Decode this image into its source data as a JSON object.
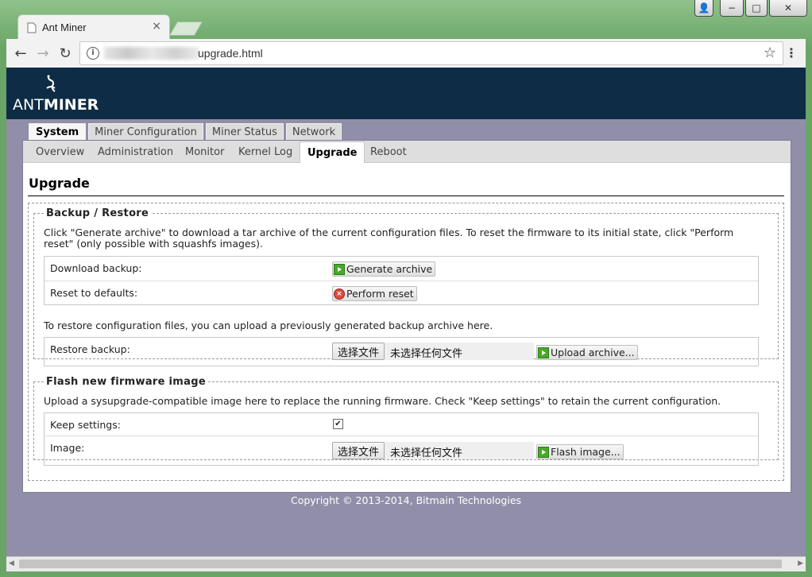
{
  "browser": {
    "tab_title": "Ant Miner",
    "tab_close": "×",
    "url_visible": "upgrade.html",
    "back": "←",
    "forward": "→",
    "reload": "↻",
    "info": "i",
    "bookmark": "☆",
    "menu": "⋮",
    "window_controls": {
      "user": "👤",
      "minimize": "−",
      "maximize": "□",
      "close": "✕"
    }
  },
  "header": {
    "logo_text_light": "ANT",
    "logo_text_bold": "MINER"
  },
  "top_tabs": [
    {
      "label": "System",
      "active": true
    },
    {
      "label": "Miner Configuration",
      "active": false
    },
    {
      "label": "Miner Status",
      "active": false
    },
    {
      "label": "Network",
      "active": false
    }
  ],
  "sub_nav": [
    {
      "label": "Overview",
      "active": false
    },
    {
      "label": "Administration",
      "active": false
    },
    {
      "label": "Monitor",
      "active": false
    },
    {
      "label": "Kernel Log",
      "active": false
    },
    {
      "label": "Upgrade",
      "active": true
    },
    {
      "label": "Reboot",
      "active": false
    }
  ],
  "page_title": "Upgrade",
  "backup": {
    "legend": "Backup / Restore",
    "description": "Click \"Generate archive\" to download a tar archive of the current configuration files. To reset the firmware to its initial state, click \"Perform reset\" (only possible with squashfs images).",
    "download_label": "Download backup:",
    "generate_button": "Generate archive",
    "reset_label": "Reset to defaults:",
    "reset_button": "Perform reset",
    "restore_description": "To restore configuration files, you can upload a previously generated backup archive here.",
    "restore_label": "Restore backup:",
    "choose_file": "选择文件",
    "no_file": "未选择任何文件",
    "upload_button": "Upload archive..."
  },
  "flash": {
    "legend": "Flash new firmware image",
    "description": "Upload a sysupgrade-compatible image here to replace the running firmware. Check \"Keep settings\" to retain the current configuration.",
    "keep_label": "Keep settings:",
    "keep_checked": true,
    "image_label": "Image:",
    "choose_file": "选择文件",
    "no_file": "未选择任何文件",
    "flash_button": "Flash image..."
  },
  "footer": "Copyright © 2013-2014, Bitmain Technologies"
}
